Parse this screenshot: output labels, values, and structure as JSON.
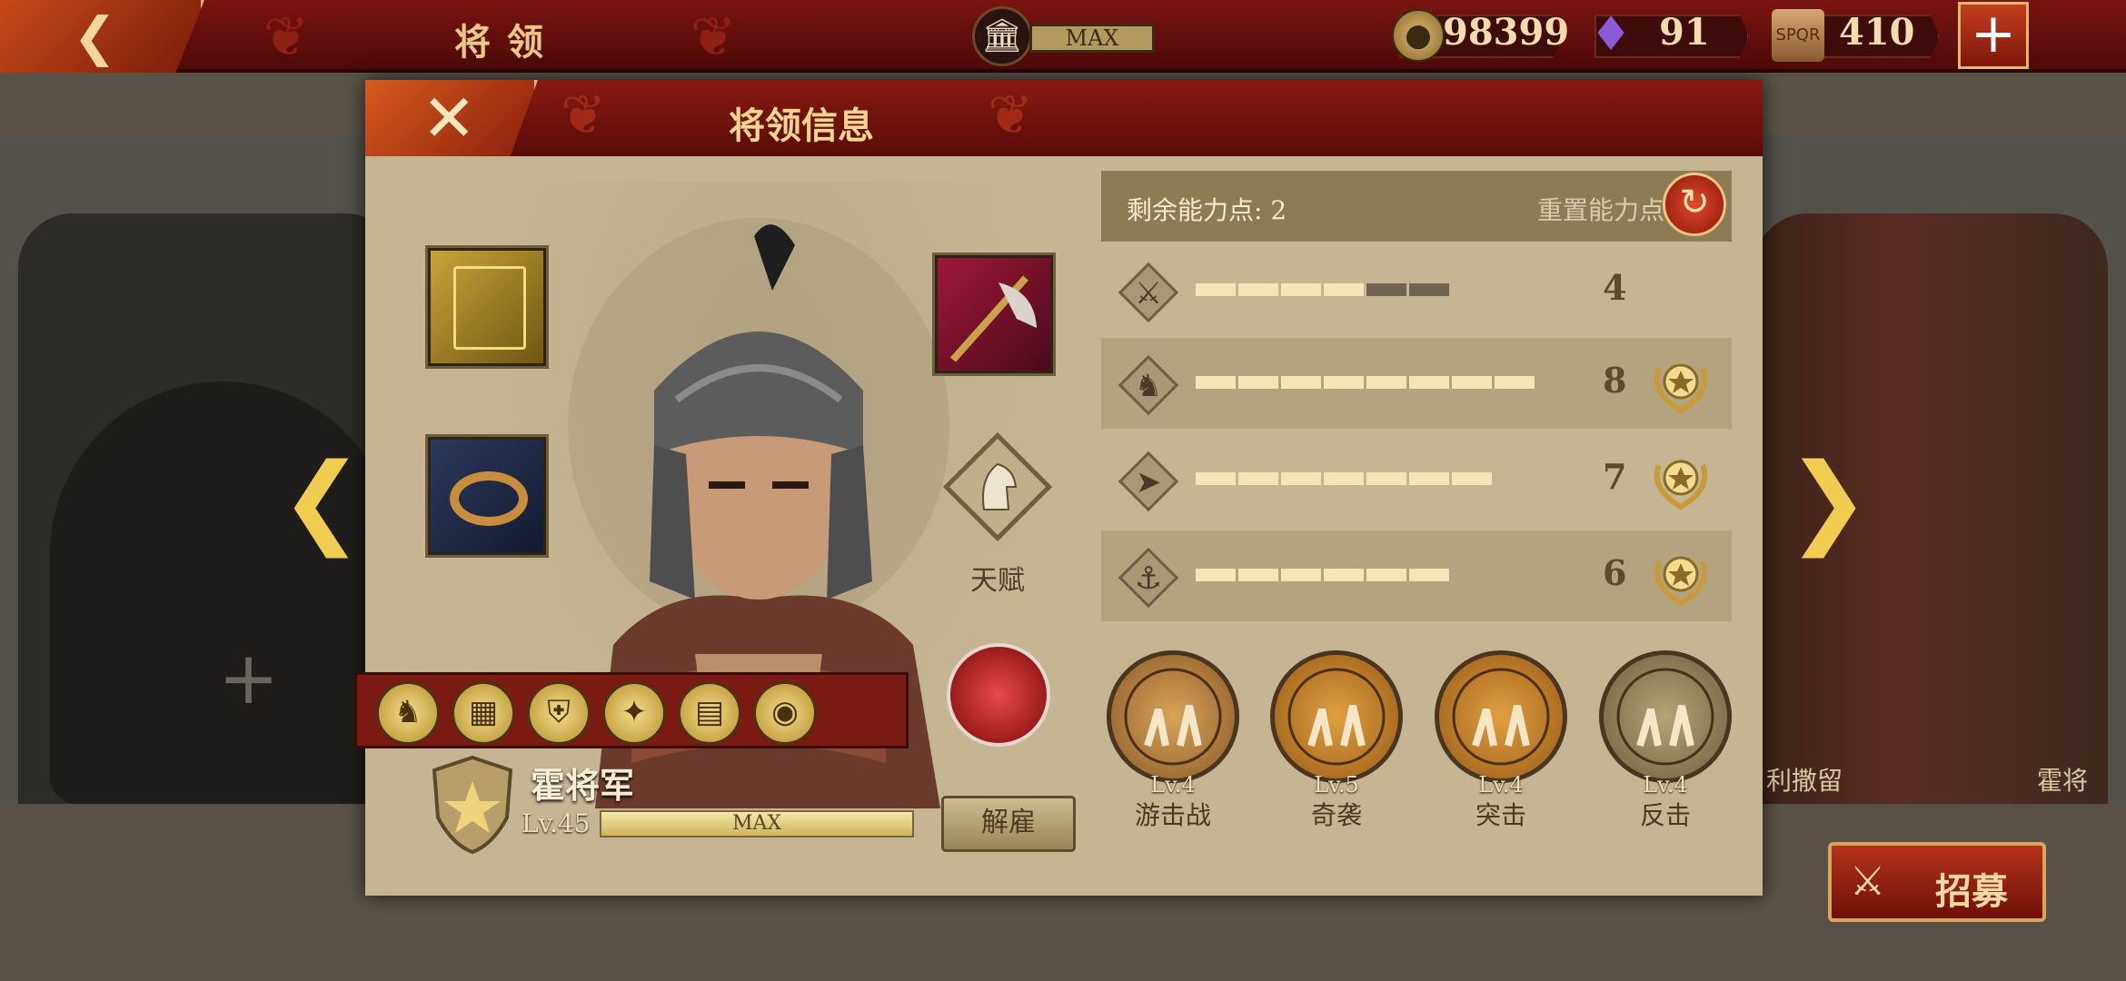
{
  "topbar": {
    "title": "将领",
    "back_icon": "back-chevron-icon",
    "building_level": "MAX",
    "resources": [
      {
        "name": "coin",
        "icon": "coin-icon",
        "value": "98399"
      },
      {
        "name": "gem",
        "icon": "crystal-icon",
        "value": "91"
      },
      {
        "name": "honor",
        "icon": "spqr-eagle-icon",
        "value": "410"
      }
    ],
    "add_icon": "plus-icon"
  },
  "modal": {
    "title": "将领信息",
    "close_icon": "close-icon",
    "equipment": [
      {
        "slot": "banner",
        "icon": "minerva-banner-icon"
      },
      {
        "slot": "crown",
        "icon": "laurel-crown-icon"
      },
      {
        "slot": "weapon",
        "icon": "axe-weapon-icon"
      }
    ],
    "talent_label": "天赋",
    "hero": {
      "name": "霍将军",
      "level": "Lv.45",
      "level_bar_text": "MAX",
      "level_progress": 1.0,
      "dismiss_label": "解雇"
    },
    "skill_badges": [
      "horse-medal-icon",
      "formation-medal-icon",
      "shield-medal-icon",
      "compass-medal-icon",
      "book-medal-icon",
      "helmet-medal-icon"
    ],
    "stats": {
      "remaining_points_label": "剩余能力点: 2",
      "reset_label": "重置能力点",
      "rows": [
        {
          "name": "infantry",
          "icon": "sword-icon",
          "filled": 4,
          "total": 6,
          "value": "4",
          "mastery": false
        },
        {
          "name": "cavalry",
          "icon": "horse-icon",
          "filled": 8,
          "total": 8,
          "value": "8",
          "mastery": true
        },
        {
          "name": "archery",
          "icon": "bow-icon",
          "filled": 7,
          "total": 7,
          "value": "7",
          "mastery": true
        },
        {
          "name": "navy",
          "icon": "anchor-icon",
          "filled": 6,
          "total": 6,
          "value": "6",
          "mastery": true
        }
      ]
    },
    "tactics": [
      {
        "level": "Lv.4",
        "name": "游击战"
      },
      {
        "level": "Lv.5",
        "name": "奇袭"
      },
      {
        "level": "Lv.4",
        "name": "突击"
      },
      {
        "level": "Lv.4",
        "name": "反击"
      }
    ]
  },
  "background": {
    "left_slot_icon": "plus-icon",
    "right_names": [
      "利撒留",
      "霍将"
    ],
    "recruit_label": "招募"
  },
  "colors": {
    "header_red": "#7a1410",
    "parchment": "#c5b592",
    "pip_filled": "#f2e6b6",
    "pip_empty": "#6f6452",
    "gold": "#e0bb6c"
  }
}
